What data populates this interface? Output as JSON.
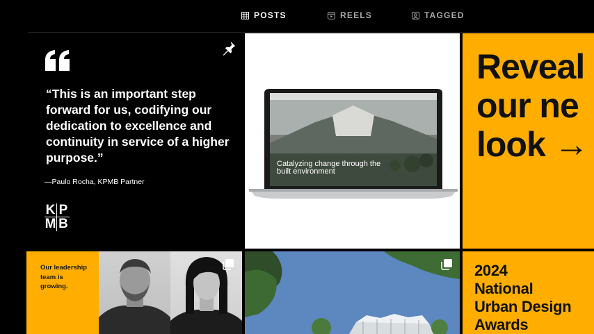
{
  "tabs": {
    "posts": "POSTS",
    "reels": "REELS",
    "tagged": "TAGGED"
  },
  "posts": {
    "quote": {
      "text": "“This is an important step forward for us, codifying our dedication to excellence and continuity in service of a higher purpose.”",
      "attribution": "—Paulo Rocha, KPMB Partner",
      "logo": [
        "K",
        "P",
        "M",
        "B"
      ],
      "pinned_icon": "pin-icon"
    },
    "website": {
      "caption": "Catalyzing change through the built environment"
    },
    "reveal": {
      "line1": "Reveal",
      "line2": "our ne",
      "line3": "look",
      "arrow": "→"
    },
    "leadership": {
      "text": "Our leadership team is growing.",
      "multi_icon": "carousel-icon"
    },
    "building": {
      "multi_icon": "carousel-icon"
    },
    "awards": {
      "line1": "2024",
      "line2": "National",
      "line3": "Urban Design",
      "line4": "Awards"
    }
  },
  "colors": {
    "accent_yellow": "#ffae00",
    "background": "#000000"
  }
}
